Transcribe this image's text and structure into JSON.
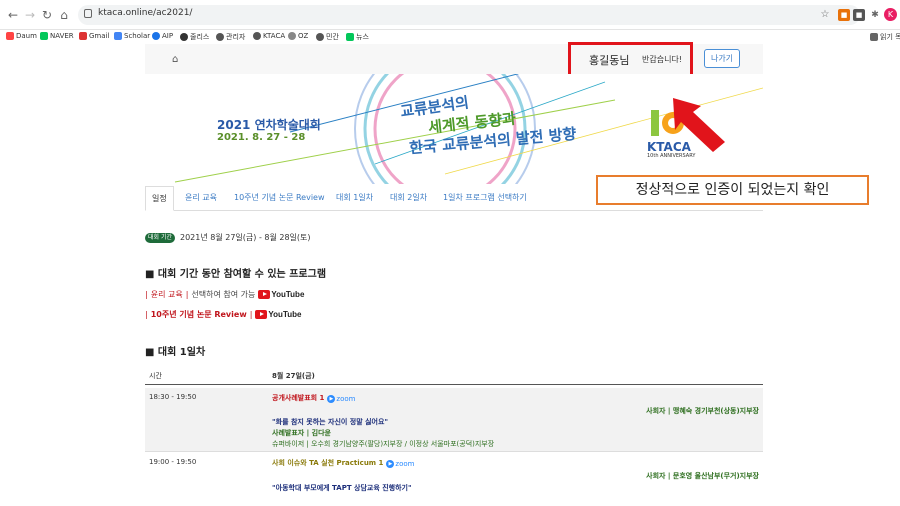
{
  "browser": {
    "url": "ktaca.online/ac2021/",
    "profile_initial": "K",
    "bookmarks": [
      "Daum",
      "NAVER",
      "Gmail",
      "Scholar",
      "AIP",
      "줄리스",
      "관리자",
      "KTACA",
      "OZ",
      "민간",
      "뉴스"
    ],
    "reading_list": "읽기 목록"
  },
  "header": {
    "user_name": "홍길동님",
    "greeting": "반갑습니다!",
    "logout_label": "나가기"
  },
  "banner": {
    "conf_title": "2021 연차학술대회",
    "conf_date": "2021. 8. 27 - 28",
    "line1": "교류분석의",
    "line2": "세계적 동향과",
    "line3": "한국 교류분석의 발전 방향",
    "logo_text": "KTACA",
    "logo_sub": "10th ANNIVERSARY",
    "logo_number": "10"
  },
  "annotation": {
    "note": "정상적으로 인증이 되었는지 확인"
  },
  "tabs": [
    "일정",
    "윤리 교육",
    "10주년 기념 논문 Review",
    "대회 1일차",
    "대회 2일차",
    "1일차 프로그램 선택하기"
  ],
  "period": {
    "badge": "대회 기간",
    "text": "2021년 8월 27일(금) - 8월 28일(토)"
  },
  "programs": {
    "title": "■ 대회 기간 동안 참여할 수 있는 프로그램",
    "item1_open": "|",
    "item1_label": "윤리 교육",
    "item1_sep": "|",
    "item1_note": "선택하여 참여 가능",
    "item2_open": "|",
    "item2_label": "10주년 기념 논문 Review",
    "item2_sep": "|",
    "youtube": "YouTube"
  },
  "day1": {
    "title": "■ 대회 1일차",
    "col_time": "시간",
    "col_date": "8월 27일(금)",
    "zoom": "zoom",
    "rows": [
      {
        "time": "18:30 - 19:50",
        "session": "공개사례발표회 1",
        "moderator": "사회자 | 맹혜숙 경기부천(상동)지부장",
        "topic": "\"화를 참지 못하는 자신이 정말 싫어요\"",
        "presenter": "사례발표자 | 김다윤",
        "supervisor": "슈퍼바이저 | 오수희 경기남양주(팔당)지부장 / 이정상 서울마포(공덕)지부장"
      },
      {
        "time": "19:00 - 19:50",
        "session": "사회 이슈와 TA 실천 Practicum 1",
        "moderator": "사회자 | 문호영 울산남부(무거)지부장",
        "topic": "\"아동학대 부모에게 TAPT 상담교육 진행하기\""
      }
    ]
  }
}
